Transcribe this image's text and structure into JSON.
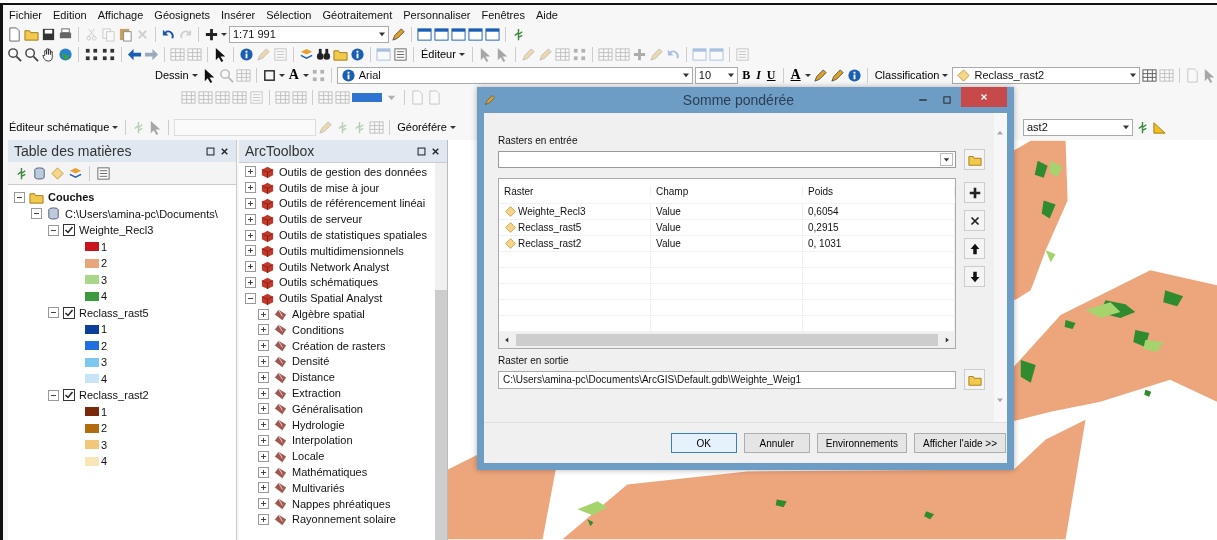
{
  "menu": [
    "Fichier",
    "Edition",
    "Affichage",
    "Géosignets",
    "Insérer",
    "Sélection",
    "Géotraitement",
    "Personnaliser",
    "Fenêtres",
    "Aide"
  ],
  "toolbars": {
    "scale": "1:71 991",
    "editor_menu": "Éditeur",
    "draw_menu": "Dessin",
    "text_tool": "A",
    "font": "Arial",
    "font_size": "10",
    "text_format": [
      "B",
      "I",
      "U"
    ],
    "font_color": "A",
    "classification_menu": "Classification",
    "layer_combo": "Reclass_rast2",
    "schematic_menu": "Éditeur schématique",
    "georef_menu": "Géoréfére",
    "georef_layer": "ast2"
  },
  "toc": {
    "title": "Table des matières",
    "tree": [
      {
        "kind": "group",
        "label": "Couches",
        "expanded": true,
        "children": [
          {
            "kind": "database",
            "label": "C:\\Users\\amina-pc\\Documents\\",
            "expanded": true,
            "children": [
              {
                "kind": "layer",
                "label": "Weighte_Recl3",
                "expanded": true,
                "checked": true,
                "legend": [
                  {
                    "label": "1",
                    "color": "#c8141c"
                  },
                  {
                    "label": "2",
                    "color": "#e8a77a"
                  },
                  {
                    "label": "3",
                    "color": "#a8d888"
                  },
                  {
                    "label": "4",
                    "color": "#3c9a3c"
                  }
                ]
              },
              {
                "kind": "layer",
                "label": "Reclass_rast5",
                "expanded": true,
                "checked": true,
                "legend": [
                  {
                    "label": "1",
                    "color": "#0b3f9a"
                  },
                  {
                    "label": "2",
                    "color": "#1f6fe0"
                  },
                  {
                    "label": "3",
                    "color": "#7cc8f0"
                  },
                  {
                    "label": "4",
                    "color": "#c8e4f8"
                  }
                ]
              },
              {
                "kind": "layer",
                "label": "Reclass_rast2",
                "expanded": true,
                "checked": true,
                "legend": [
                  {
                    "label": "1",
                    "color": "#7a2a08"
                  },
                  {
                    "label": "2",
                    "color": "#b06d10"
                  },
                  {
                    "label": "3",
                    "color": "#f3c77a"
                  },
                  {
                    "label": "4",
                    "color": "#f8e6b8"
                  }
                ]
              }
            ]
          }
        ]
      }
    ]
  },
  "toolbox": {
    "title": "ArcToolbox",
    "items": [
      {
        "label": "Outils de gestion des données",
        "expanded": false
      },
      {
        "label": "Outils de mise à jour",
        "expanded": false
      },
      {
        "label": "Outils de référencement linéai",
        "expanded": false
      },
      {
        "label": "Outils de serveur",
        "expanded": false
      },
      {
        "label": "Outils de statistiques spatiales",
        "expanded": false
      },
      {
        "label": "Outils multidimensionnels",
        "expanded": false
      },
      {
        "label": "Outils Network Analyst",
        "expanded": false
      },
      {
        "label": "Outils schématiques",
        "expanded": false
      },
      {
        "label": "Outils Spatial Analyst",
        "expanded": true,
        "children": [
          {
            "label": "Algèbre spatial",
            "expanded": false
          },
          {
            "label": "Conditions",
            "expanded": false
          },
          {
            "label": "Création de rasters",
            "expanded": false
          },
          {
            "label": "Densité",
            "expanded": false
          },
          {
            "label": "Distance",
            "expanded": false
          },
          {
            "label": "Extraction",
            "expanded": false
          },
          {
            "label": "Généralisation",
            "expanded": false
          },
          {
            "label": "Hydrologie",
            "expanded": false
          },
          {
            "label": "Interpolation",
            "expanded": false
          },
          {
            "label": "Locale",
            "expanded": false
          },
          {
            "label": "Mathématiques",
            "expanded": false
          },
          {
            "label": "Multivariés",
            "expanded": false
          },
          {
            "label": "Nappes phréatiques",
            "expanded": false
          },
          {
            "label": "Rayonnement solaire",
            "expanded": false
          }
        ]
      }
    ]
  },
  "dialog": {
    "title": "Somme pondérée",
    "input_label": "Rasters en entrée",
    "table": {
      "columns": [
        "Raster",
        "Champ",
        "Poids"
      ],
      "rows": [
        {
          "raster": "Weighte_Recl3",
          "field": "Value",
          "weight": "0,6054"
        },
        {
          "raster": "Reclass_rast5",
          "field": "Value",
          "weight": "0,2915"
        },
        {
          "raster": "Reclass_rast2",
          "field": "Value",
          "weight": "0, 1031"
        }
      ]
    },
    "output_label": "Raster en sortie",
    "output_value": "C:\\Users\\amina-pc\\Documents\\ArcGIS\\Default.gdb\\Weighte_Weig1",
    "buttons": [
      "OK",
      "Annuler",
      "Environnements",
      "Afficher l'aide >>"
    ]
  }
}
